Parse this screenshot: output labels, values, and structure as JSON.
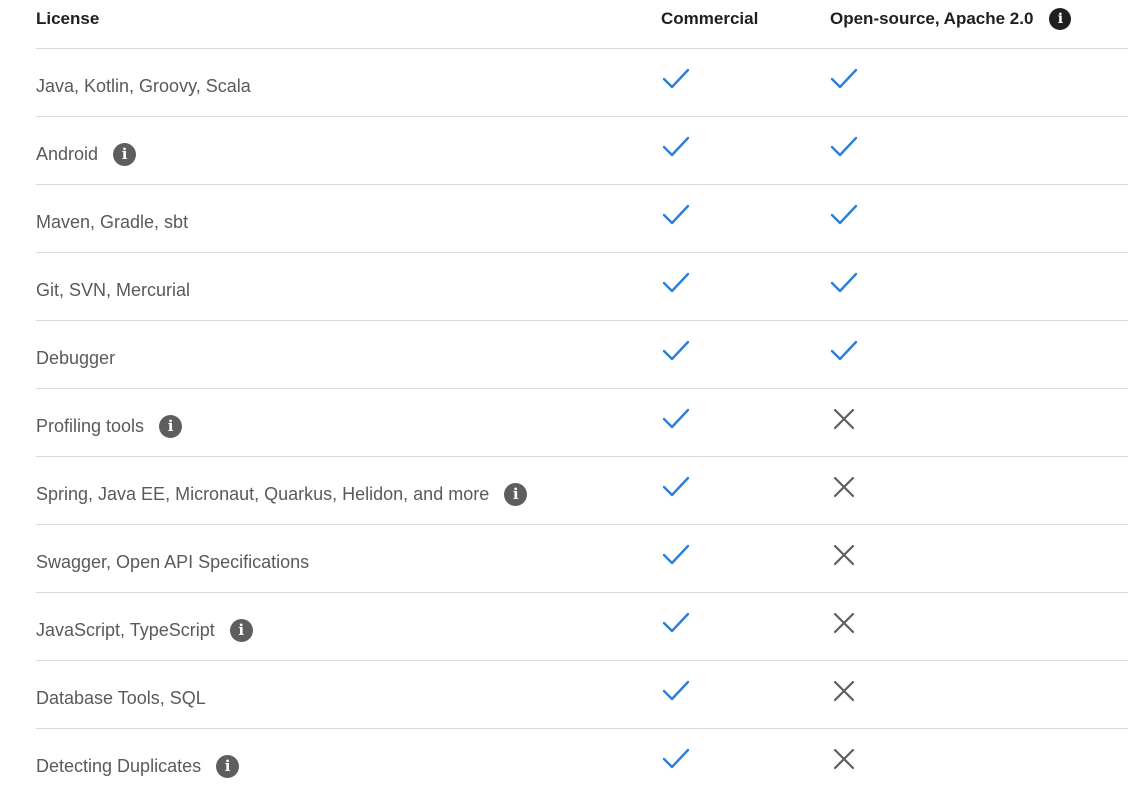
{
  "header": {
    "license": "License",
    "commercial": "Commercial",
    "opensource": "Open-source, Apache 2.0",
    "opensource_info_icon": "info-icon"
  },
  "colors": {
    "check": "#2b7fd6",
    "cross": "#5e5e5e",
    "info": "#5e5e5e"
  },
  "rows": [
    {
      "label": "Java, Kotlin, Groovy, Scala",
      "info": false,
      "commercial": "check",
      "opensource": "check"
    },
    {
      "label": "Android",
      "info": true,
      "commercial": "check",
      "opensource": "check"
    },
    {
      "label": "Maven, Gradle, sbt",
      "info": false,
      "commercial": "check",
      "opensource": "check"
    },
    {
      "label": "Git, SVN, Mercurial",
      "info": false,
      "commercial": "check",
      "opensource": "check"
    },
    {
      "label": "Debugger",
      "info": false,
      "commercial": "check",
      "opensource": "check"
    },
    {
      "label": "Profiling tools",
      "info": true,
      "commercial": "check",
      "opensource": "cross"
    },
    {
      "label": "Spring, Java EE, Micronaut, Quarkus, Helidon, and more",
      "info": true,
      "commercial": "check",
      "opensource": "cross"
    },
    {
      "label": "Swagger, Open API Specifications",
      "info": false,
      "commercial": "check",
      "opensource": "cross"
    },
    {
      "label": "JavaScript, TypeScript",
      "info": true,
      "commercial": "check",
      "opensource": "cross"
    },
    {
      "label": "Database Tools, SQL",
      "info": false,
      "commercial": "check",
      "opensource": "cross"
    },
    {
      "label": "Detecting Duplicates",
      "info": true,
      "commercial": "check",
      "opensource": "cross"
    }
  ]
}
